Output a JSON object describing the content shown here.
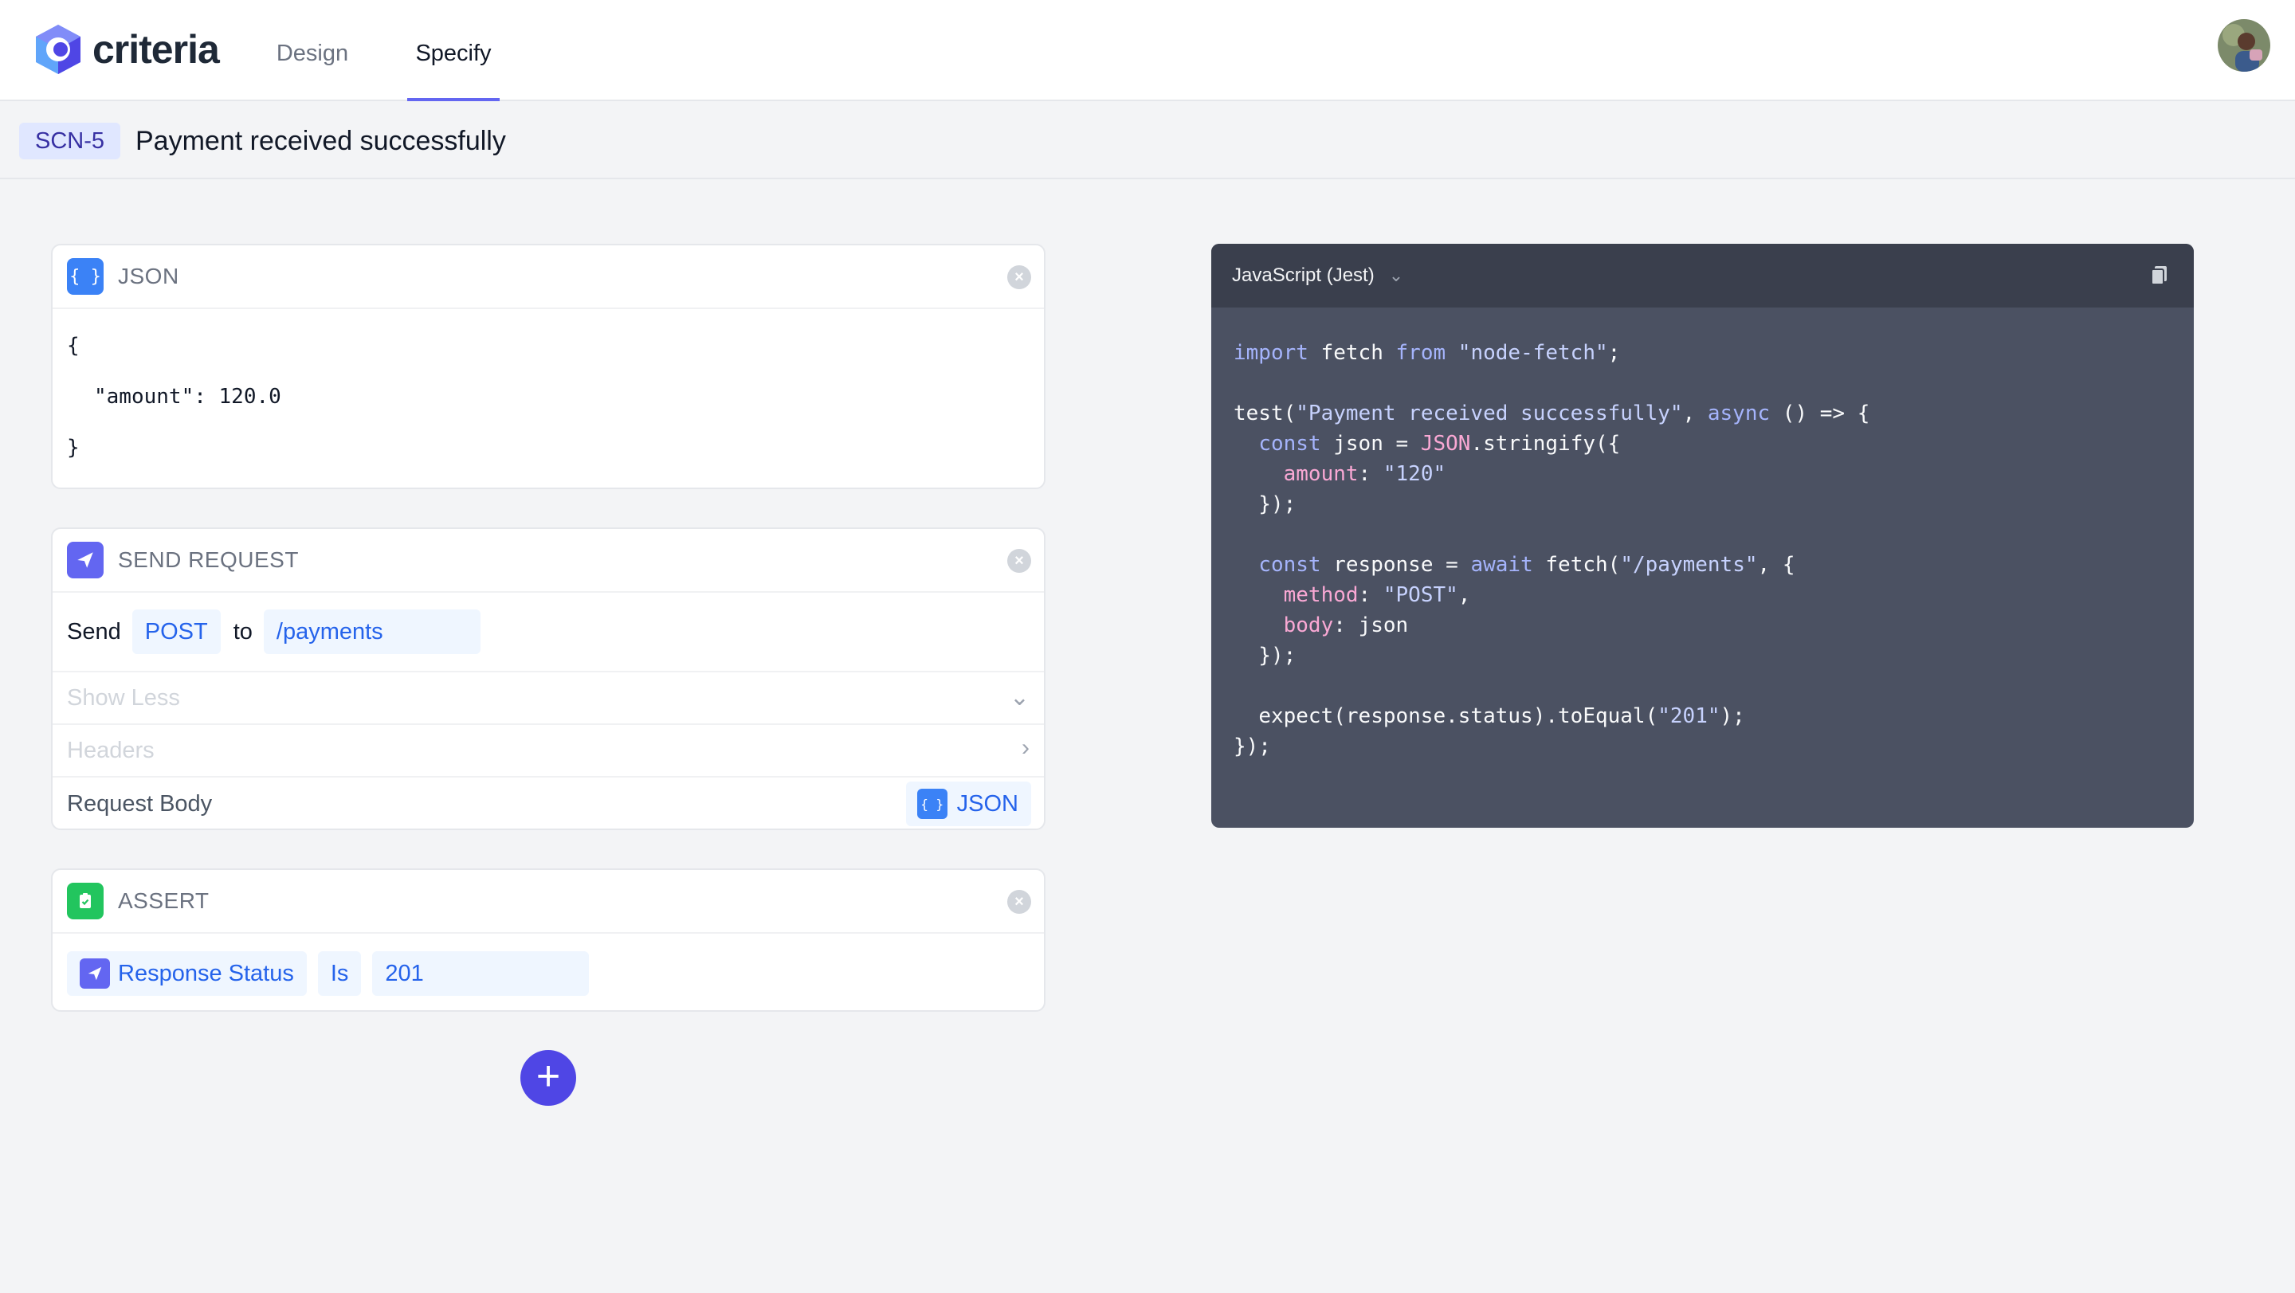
{
  "app": {
    "name": "criteria",
    "brand_color": "#4f46e5",
    "nav_tabs": [
      {
        "label": "Design",
        "active": false
      },
      {
        "label": "Specify",
        "active": true
      }
    ]
  },
  "scenario": {
    "id": "SCN-5",
    "title": "Payment received successfully"
  },
  "json_block": {
    "title": "JSON",
    "lines": [
      "{",
      "\"amount\": 120.0",
      "}"
    ]
  },
  "send_block": {
    "title": "SEND REQUEST",
    "send_label": "Send",
    "method": "POST",
    "to_label": "to",
    "path": "/payments",
    "show_less_label": "Show Less",
    "headers_label": "Headers",
    "request_body_label": "Request Body",
    "body_type": "JSON"
  },
  "assert_block": {
    "title": "ASSERT",
    "subject": "Response Status",
    "operator": "Is",
    "value": "201"
  },
  "add_button_label": "+",
  "code_panel": {
    "language": "JavaScript (Jest)",
    "lines": [
      "import fetch from \"node-fetch\";",
      "",
      "test(\"Payment received successfully\", async () => {",
      "  const json = JSON.stringify({",
      "    amount: \"120\"",
      "  });",
      "",
      "  const response = await fetch(\"/payments\", {",
      "    method: \"POST\",",
      "    body: json",
      "  });",
      "",
      "  expect(response.status).toEqual(\"201\");",
      "});"
    ]
  }
}
